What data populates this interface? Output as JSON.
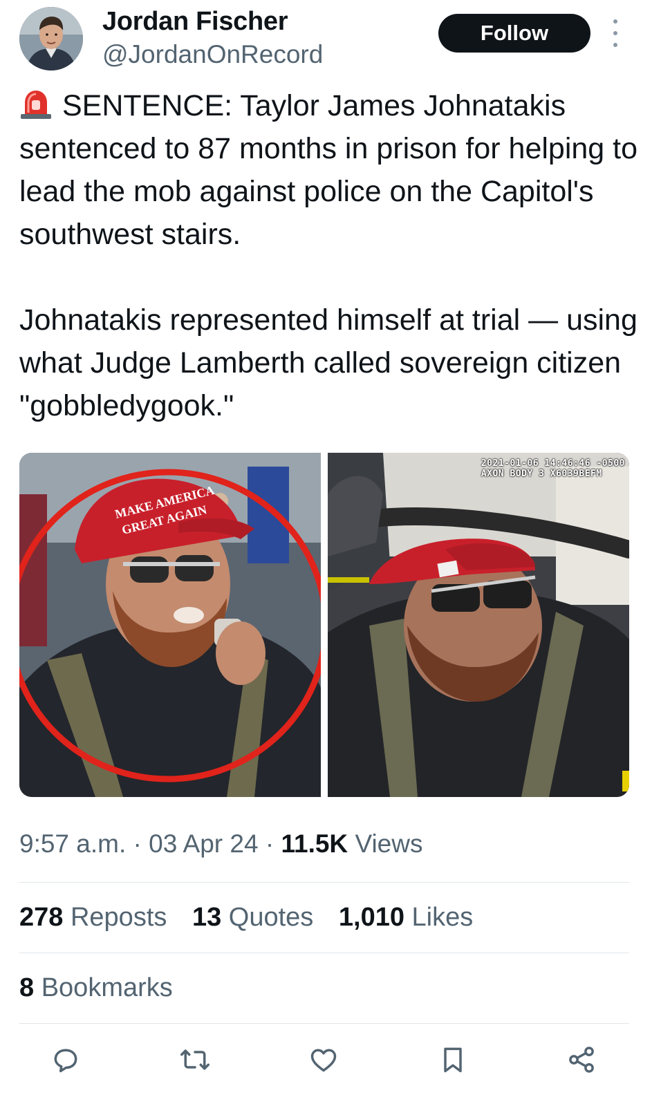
{
  "author": {
    "name": "Jordan Fischer",
    "handle": "@JordanOnRecord",
    "follow_label": "Follow"
  },
  "tweet": {
    "emoji": "🚨",
    "paragraph_1": "SENTENCE: Taylor James Johnatakis sentenced to 87 months in prison for helping to lead the mob against police on the Capitol's southwest stairs.",
    "paragraph_2": "Johnatakis represented himself at trial — using what Judge Lamberth called sovereign citizen \"gobbledygook.\""
  },
  "media": {
    "left_hat_text": "MAKE AMERICA GREAT AGAIN",
    "right_timestamp_line1": "2021-01-06 14:46:46 -0500",
    "right_timestamp_line2": "AXON BODY 3 X6039BEFM"
  },
  "meta": {
    "time": "9:57 a.m.",
    "separator": "·",
    "date": "03 Apr 24",
    "views_count": "11.5K",
    "views_label": "Views"
  },
  "stats": {
    "reposts_count": "278",
    "reposts_label": "Reposts",
    "quotes_count": "13",
    "quotes_label": "Quotes",
    "likes_count": "1,010",
    "likes_label": "Likes",
    "bookmarks_count": "8",
    "bookmarks_label": "Bookmarks"
  },
  "actions": [
    "reply-icon",
    "repost-icon",
    "like-icon",
    "bookmark-icon",
    "share-icon"
  ],
  "colors": {
    "text": "#0f1419",
    "secondary": "#536471",
    "divider": "#e1e6ea",
    "follow_bg": "#0f1419",
    "highlight_ring": "#e0231b",
    "maga_hat": "#c8202b"
  }
}
